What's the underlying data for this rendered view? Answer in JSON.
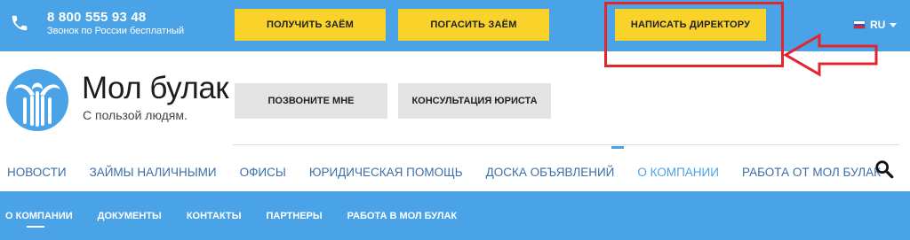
{
  "topbar": {
    "phone_number": "8 800 555 93 48",
    "phone_caption": "Звонок по России бесплатный",
    "buttons": {
      "get_loan": "ПОЛУЧИТЬ ЗАЁМ",
      "repay_loan": "ПОГАСИТЬ ЗАЁМ",
      "write_director": "НАПИСАТЬ ДИРЕКТОРУ"
    },
    "language": "RU"
  },
  "brand": {
    "name": "Мол булак",
    "tagline": "С пользой людям."
  },
  "header_buttons": {
    "call_me": "ПОЗВОНИТЕ МНЕ",
    "lawyer_consult": "КОНСУЛЬТАЦИЯ ЮРИСТА"
  },
  "nav": {
    "items": [
      {
        "label": "НОВОСТИ"
      },
      {
        "label": "ЗАЙМЫ НАЛИЧНЫМИ"
      },
      {
        "label": "ОФИСЫ"
      },
      {
        "label": "ЮРИДИЧЕСКАЯ ПОМОЩЬ"
      },
      {
        "label": "ДОСКА ОБЪЯВЛЕНИЙ"
      },
      {
        "label": "О КОМПАНИИ"
      },
      {
        "label": "РАБОТА ОТ МОЛ БУЛАК"
      }
    ],
    "active": "О КОМПАНИИ"
  },
  "subnav": {
    "items": [
      {
        "label": "О КОМПАНИИ"
      },
      {
        "label": "ДОКУМЕНТЫ"
      },
      {
        "label": "КОНТАКТЫ"
      },
      {
        "label": "ПАРТНЕРЫ"
      },
      {
        "label": "РАБОТА В МОЛ БУЛАК"
      }
    ],
    "active": "О КОМПАНИИ"
  },
  "colors": {
    "primary_blue": "#4aa3e6",
    "accent_yellow": "#f9d22a",
    "annotation_red": "#e3262d",
    "nav_text": "#3a6fa8",
    "secondary_button": "#e3e3e3"
  },
  "icons": {
    "phone": "phone-icon",
    "flag": "russia-flag-icon",
    "dropdown": "chevron-down-icon",
    "search": "search-icon",
    "logo": "mol-bulak-logo-icon",
    "annotation": "arrow-left-icon"
  }
}
